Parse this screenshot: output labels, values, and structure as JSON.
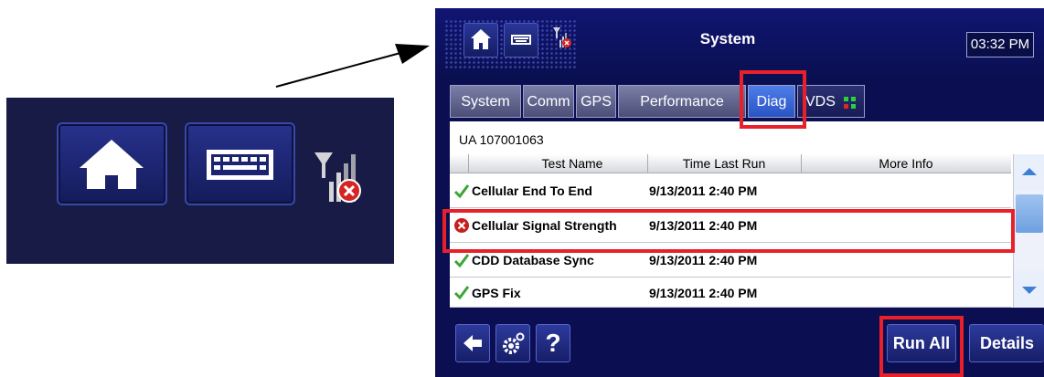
{
  "window": {
    "title": "System",
    "clock": "03:32 PM"
  },
  "toolbar_icons": [
    "home-icon",
    "keyboard-icon",
    "signal-no-connection-icon"
  ],
  "tabs": [
    {
      "label": "System",
      "active": false
    },
    {
      "label": "Comm",
      "active": false
    },
    {
      "label": "GPS",
      "active": false
    },
    {
      "label": "Performance",
      "active": false
    },
    {
      "label": "Diag",
      "active": true
    },
    {
      "label": "VDS",
      "active": false
    }
  ],
  "panel": {
    "unit_id": "UA 107001063",
    "columns": [
      "Test Name",
      "Time Last Run",
      "More Info"
    ],
    "rows": [
      {
        "name": "Cellular  End To End",
        "time": "9/13/2011 2:40 PM",
        "status": "pass",
        "icon": "check-icon"
      },
      {
        "name": "Cellular Signal Strength",
        "time": "9/13/2011 2:40 PM",
        "status": "fail",
        "icon": "error-icon"
      },
      {
        "name": "CDD Database Sync",
        "time": "9/13/2011 2:40 PM",
        "status": "pass",
        "icon": "check-icon"
      },
      {
        "name": "GPS Fix",
        "time": "9/13/2011 2:40 PM",
        "status": "pass",
        "icon": "check-icon"
      }
    ]
  },
  "bottom": {
    "run_all": "Run All",
    "details": "Details",
    "help": "?"
  },
  "colors": {
    "highlight": "#e8202a",
    "active_tab": "#3a66d8",
    "background": "#0b0f52",
    "pass": "#3aa637",
    "fail": "#c81e1e"
  }
}
